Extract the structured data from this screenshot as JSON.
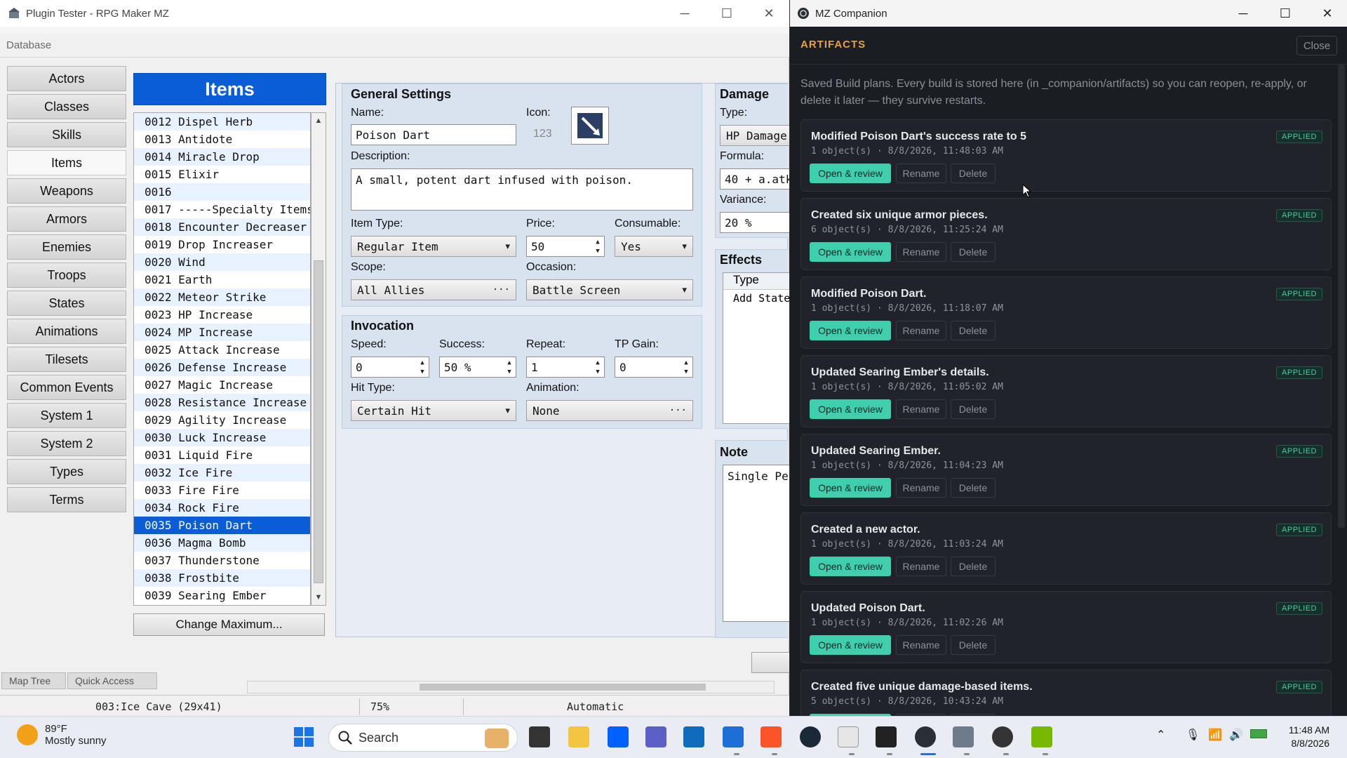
{
  "rpg_window": {
    "title": "Plugin Tester - RPG Maker MZ",
    "database_label": "Database",
    "categories": [
      "Actors",
      "Classes",
      "Skills",
      "Items",
      "Weapons",
      "Armors",
      "Enemies",
      "Troops",
      "States",
      "Animations",
      "Tilesets",
      "Common Events",
      "System 1",
      "System 2",
      "Types",
      "Terms"
    ],
    "active_category": "Items",
    "items_header": "Items",
    "items": [
      "0012 Dispel Herb",
      "0013 Antidote",
      "0014 Miracle Drop",
      "0015 Elixir",
      "0016",
      "0017 -----Specialty Items",
      "0018 Encounter Decreaser",
      "0019 Drop Increaser",
      "0020 Wind",
      "0021 Earth",
      "0022 Meteor Strike",
      "0023 HP Increase",
      "0024 MP Increase",
      "0025 Attack Increase",
      "0026 Defense Increase",
      "0027 Magic Increase",
      "0028 Resistance Increase",
      "0029 Agility Increase",
      "0030 Luck Increase",
      "0031 Liquid Fire",
      "0032 Ice Fire",
      "0033 Fire Fire",
      "0034 Rock Fire",
      "0035 Poison Dart",
      "0036 Magma Bomb",
      "0037 Thunderstone",
      "0038 Frostbite",
      "0039 Searing Ember"
    ],
    "selected_item": "0035 Poison Dart",
    "change_max_label": "Change Maximum...",
    "general": {
      "title": "General Settings",
      "name_label": "Name:",
      "name_value": "Poison Dart",
      "icon_label": "Icon:",
      "icon_index": "123",
      "desc_label": "Description:",
      "desc_value": "A small, potent dart infused with poison.",
      "item_type_label": "Item Type:",
      "item_type_value": "Regular Item",
      "price_label": "Price:",
      "price_value": "50",
      "consumable_label": "Consumable:",
      "consumable_value": "Yes",
      "scope_label": "Scope:",
      "scope_value": "All Allies",
      "occasion_label": "Occasion:",
      "occasion_value": "Battle Screen"
    },
    "invocation": {
      "title": "Invocation",
      "speed_label": "Speed:",
      "speed_value": "0",
      "success_label": "Success:",
      "success_value": "50 %",
      "repeat_label": "Repeat:",
      "repeat_value": "1",
      "tp_label": "TP Gain:",
      "tp_value": "0",
      "hit_label": "Hit Type:",
      "hit_value": "Certain Hit",
      "anim_label": "Animation:",
      "anim_value": "None"
    },
    "damage": {
      "title": "Damage",
      "type_label": "Type:",
      "type_value": "HP Damage",
      "formula_label": "Formula:",
      "formula_value": "40 + a.atk",
      "variance_label": "Variance:",
      "variance_value": "20 %"
    },
    "effects": {
      "title": "Effects",
      "col_type": "Type",
      "row1": "Add State"
    },
    "note": {
      "title": "Note",
      "value": "Single Pers"
    },
    "lower_tabs": [
      "Map Tree",
      "Quick Access"
    ],
    "status": {
      "map": "003:Ice Cave (29x41)",
      "zoom": "75%",
      "mode": "Automatic"
    }
  },
  "companion": {
    "title": "MZ Companion",
    "heading": "ARTIFACTS",
    "close_label": "Close",
    "description": "Saved Build plans. Every build is stored here (in _companion/artifacts) so you can reopen, re-apply, or delete it later — they survive restarts.",
    "open_label": "Open & review",
    "rename_label": "Rename",
    "delete_label": "Delete",
    "artifacts": [
      {
        "title": "Modified Poison Dart's success rate to 5",
        "meta": "1 object(s) · 8/8/2026, 11:48:03 AM",
        "status": "APPLIED"
      },
      {
        "title": "Created six unique armor pieces.",
        "meta": "6 object(s) · 8/8/2026, 11:25:24 AM",
        "status": "APPLIED"
      },
      {
        "title": "Modified Poison Dart.",
        "meta": "1 object(s) · 8/8/2026, 11:18:07 AM",
        "status": "APPLIED"
      },
      {
        "title": "Updated Searing Ember's details.",
        "meta": "1 object(s) · 8/8/2026, 11:05:02 AM",
        "status": "APPLIED"
      },
      {
        "title": "Updated Searing Ember.",
        "meta": "1 object(s) · 8/8/2026, 11:04:23 AM",
        "status": "APPLIED"
      },
      {
        "title": "Created a new actor.",
        "meta": "1 object(s) · 8/8/2026, 11:03:24 AM",
        "status": "APPLIED"
      },
      {
        "title": "Updated Poison Dart.",
        "meta": "1 object(s) · 8/8/2026, 11:02:26 AM",
        "status": "APPLIED"
      },
      {
        "title": "Created five unique damage-based items.",
        "meta": "5 object(s) · 8/8/2026, 10:43:24 AM",
        "status": "APPLIED"
      }
    ],
    "accent_color": "#3fcfae",
    "heading_color": "#e5a04a"
  },
  "taskbar": {
    "weather_temp": "89°F",
    "weather_cond": "Mostly sunny",
    "search_label": "Search",
    "time": "11:48 AM",
    "date": "8/8/2026"
  }
}
